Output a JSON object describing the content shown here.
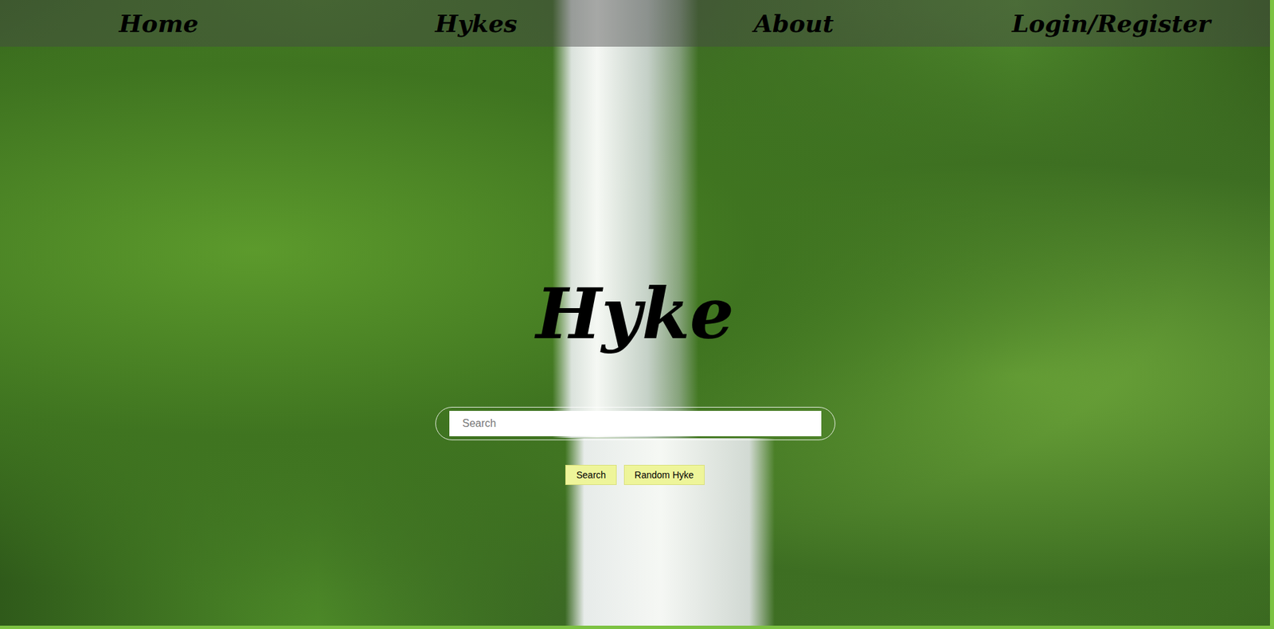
{
  "nav": {
    "items": [
      {
        "label": "Home"
      },
      {
        "label": "Hykes"
      },
      {
        "label": "About"
      },
      {
        "label": "Login/Register"
      }
    ]
  },
  "hero": {
    "title": "Hyke"
  },
  "search": {
    "placeholder": "Search"
  },
  "buttons": [
    {
      "label": "Search"
    },
    {
      "label": "Random Hyke"
    }
  ]
}
